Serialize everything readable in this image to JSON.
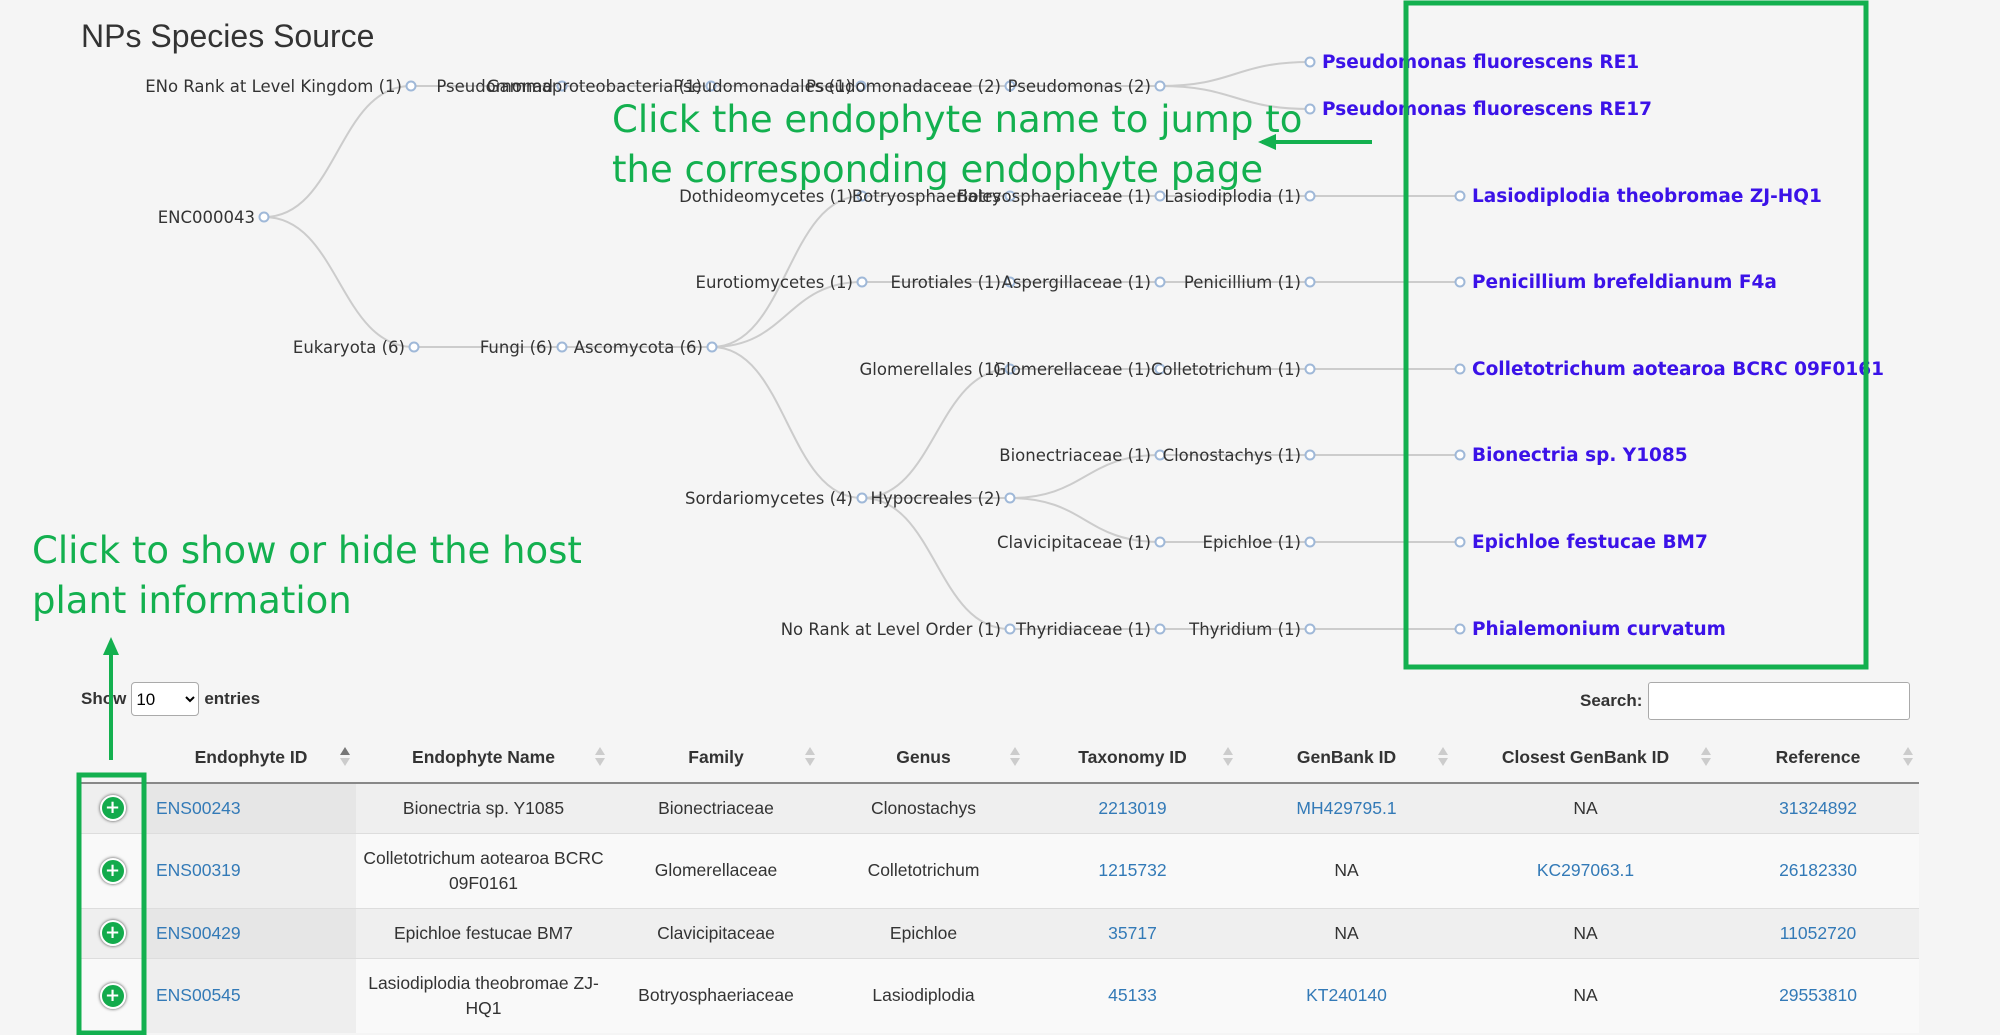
{
  "page": {
    "title": "NPs Species Source"
  },
  "tree": {
    "root": "ENC000043",
    "ranks": [
      "ENo Rank at Level Kingdom (1)",
      "Pseudomonad",
      "Gammaproteobacteria (1)",
      "Pseudomonadales (1)",
      "Pseudomonadaceae (2)",
      "Pseudomonas (2)",
      "Eukaryota (6)",
      "Fungi (6)",
      "Ascomycota (6)",
      "Dothideomycetes (1)",
      "Botryosphaeriales",
      "Botryosphaeriaceae (1)",
      "Lasiodiplodia (1)",
      "Eurotiomycetes (1)",
      "Eurotiales (1)",
      "Aspergillaceae (1)",
      "Penicillium (1)",
      "Glomerellales (1)",
      "Glomerellaceae (1)",
      "Colletotrichum (1)",
      "Sordariomycetes (4)",
      "Hypocreales (2)",
      "Bionectriaceae (1)",
      "Clonostachys (1)",
      "Clavicipitaceae (1)",
      "Epichloe (1)",
      "No Rank at Level Order (1)",
      "Thyridiaceae (1)",
      "Thyridium (1)"
    ],
    "leaves": [
      "Pseudomonas fluorescens RE1",
      "Pseudomonas fluorescens RE17",
      "Lasiodiplodia theobromae ZJ-HQ1",
      "Penicillium brefeldianum F4a",
      "Colletotrichum aotearoa BCRC 09F0161",
      "Bionectria sp. Y1085",
      "Epichloe festucae BM7",
      "Phialemonium curvatum"
    ]
  },
  "annotations": {
    "leaf_hint_line1": "Click the endophyte name to jump to",
    "leaf_hint_line2": "the corresponding endophyte page",
    "host_hint_line1": "Click to show or hide the host",
    "host_hint_line2": "plant information",
    "color": "#13b04f"
  },
  "controls": {
    "show_label": "Show",
    "entries_label": "entries",
    "entries_value": "10",
    "search_label": "Search:"
  },
  "table": {
    "columns": [
      "",
      "Endophyte ID",
      "Endophyte Name",
      "Family",
      "Genus",
      "Taxonomy ID",
      "GenBank ID",
      "Closest GenBank ID",
      "Reference"
    ],
    "rows": [
      {
        "id": "ENS00243",
        "name": "Bionectria sp. Y1085",
        "family": "Bionectriaceae",
        "genus": "Clonostachys",
        "taxonomy_id": "2213019",
        "genbank_id": "MH429795.1",
        "closest_genbank_id": "NA",
        "reference": "31324892"
      },
      {
        "id": "ENS00319",
        "name": "Colletotrichum aotearoa BCRC 09F0161",
        "family": "Glomerellaceae",
        "genus": "Colletotrichum",
        "taxonomy_id": "1215732",
        "genbank_id": "NA",
        "closest_genbank_id": "KC297063.1",
        "reference": "26182330"
      },
      {
        "id": "ENS00429",
        "name": "Epichloe festucae BM7",
        "family": "Clavicipitaceae",
        "genus": "Epichloe",
        "taxonomy_id": "35717",
        "genbank_id": "NA",
        "closest_genbank_id": "NA",
        "reference": "11052720"
      },
      {
        "id": "ENS00545",
        "name": "Lasiodiplodia theobromae ZJ-HQ1",
        "family": "Botryosphaeriaceae",
        "genus": "Lasiodiplodia",
        "taxonomy_id": "45133",
        "genbank_id": "KT240140",
        "closest_genbank_id": "NA",
        "reference": "29553810"
      }
    ],
    "expand_icon": "plus-circle-icon"
  },
  "colors": {
    "leaf_link": "#3b12e8",
    "table_link": "#337ab7",
    "highlight_box": "#13b04f",
    "expand_button": "#13ab4c"
  }
}
